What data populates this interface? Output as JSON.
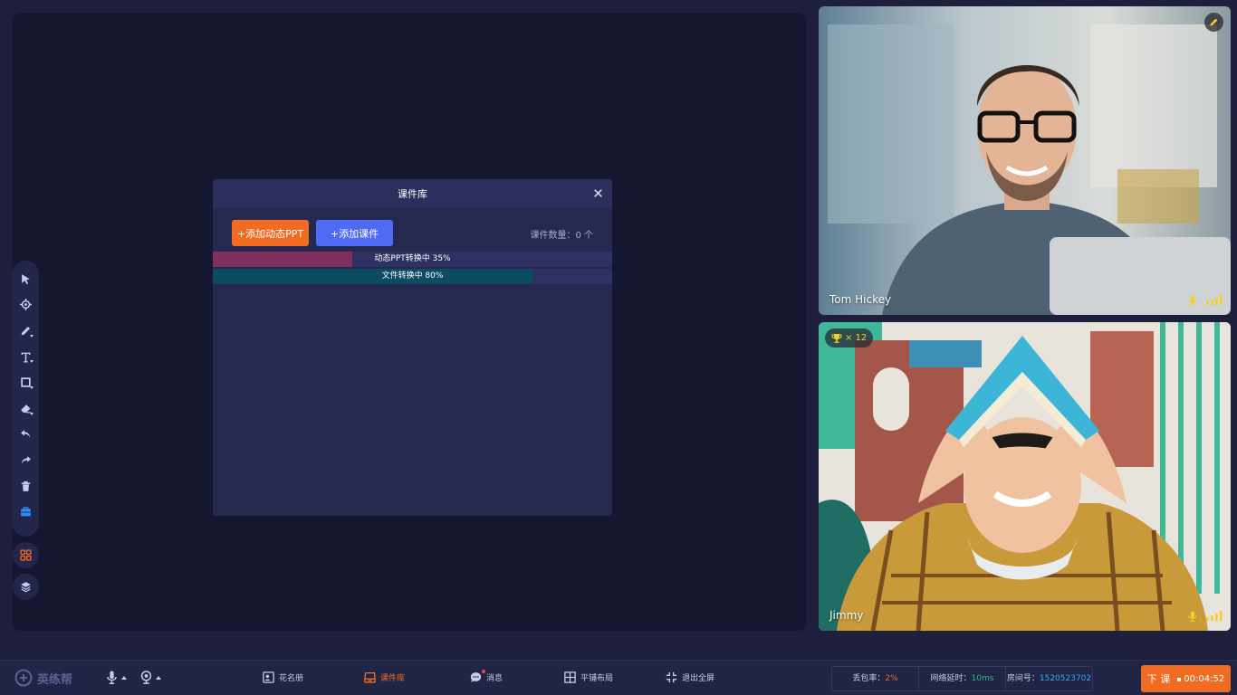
{
  "modal": {
    "title": "课件库",
    "add_dynamic_ppt": "+添加动态PPT",
    "add_courseware": "+添加课件",
    "count_label": "课件数量：0 个",
    "progress": [
      {
        "label": "动态PPT转换中  35%",
        "percent": 35,
        "color": "#80305d"
      },
      {
        "label": "文件转换中  80%",
        "percent": 80,
        "color": "#0d4b63"
      }
    ]
  },
  "videos": [
    {
      "name": "Tom Hickey"
    },
    {
      "name": "Jimmy",
      "trophy": "× 12"
    }
  ],
  "bottombar": {
    "brand": "英练帮",
    "nav": [
      {
        "label": "花名册",
        "icon": "roster-icon"
      },
      {
        "label": "课件库",
        "icon": "courseware-icon"
      },
      {
        "label": "消息",
        "icon": "message-icon"
      },
      {
        "label": "平铺布局",
        "icon": "tile-layout-icon"
      },
      {
        "label": "退出全屏",
        "icon": "exit-fullscreen-icon"
      }
    ],
    "stats": {
      "loss_label": "丢包率：",
      "loss_value": "2%",
      "latency_label": "网络延时：",
      "latency_value": "10ms",
      "room_label": "房间号：",
      "room_value": "1520523702"
    },
    "end_class": "下 课",
    "timer": "00:04:52"
  },
  "colors": {
    "accent": "#f26b22",
    "blue": "#4f6af5",
    "green": "#26c281",
    "red": "#e5484d"
  }
}
